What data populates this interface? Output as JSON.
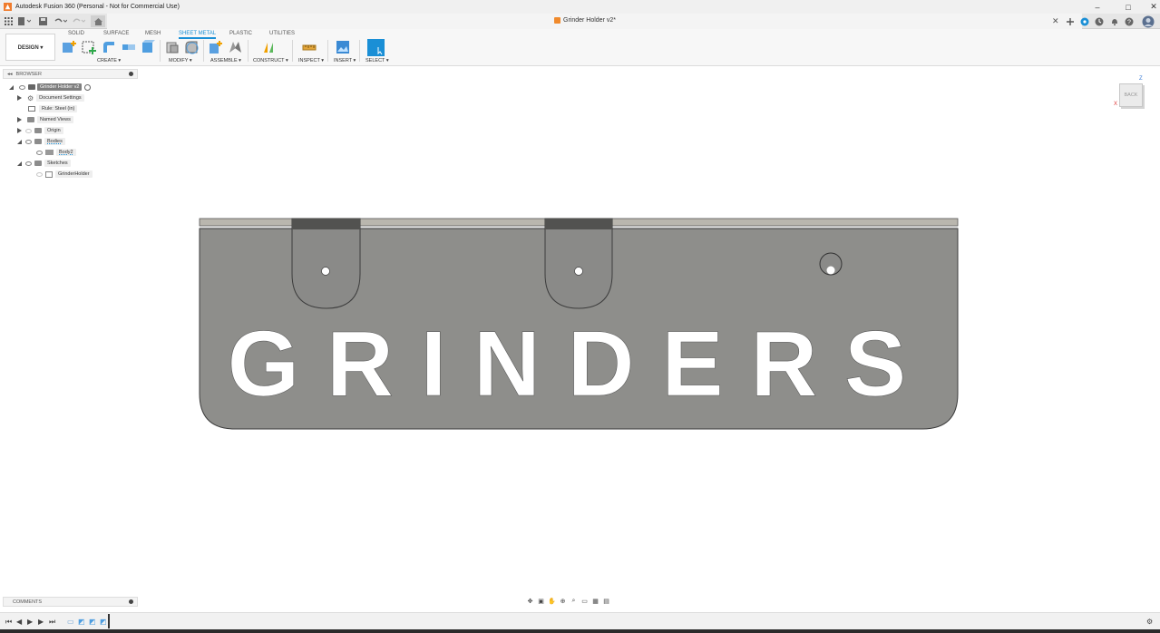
{
  "window": {
    "title": "Autodesk Fusion 360 (Personal - Not for Commercial Use)",
    "min": "–",
    "max": "□",
    "close": "✕"
  },
  "document": {
    "title": "Grinder Holder v2*",
    "close": "✕"
  },
  "workspace": {
    "label": "DESIGN ▾"
  },
  "tabs": [
    "SOLID",
    "SURFACE",
    "MESH",
    "SHEET METAL",
    "PLASTIC",
    "UTILITIES"
  ],
  "active_tab": "SHEET METAL",
  "groups": {
    "create": "CREATE ▾",
    "modify": "MODIFY ▾",
    "assemble": "ASSEMBLE ▾",
    "construct": "CONSTRUCT ▾",
    "inspect": "INSPECT ▾",
    "insert": "INSERT ▾",
    "select": "SELECT ▾"
  },
  "browser": {
    "header": "BROWSER",
    "items": [
      {
        "label": "Grinder Holder v2"
      },
      {
        "label": "Document Settings"
      },
      {
        "label": "Rule: Steel (in)"
      },
      {
        "label": "Named Views"
      },
      {
        "label": "Origin"
      },
      {
        "label": "Bodies"
      },
      {
        "label": "Body2"
      },
      {
        "label": "Sketches"
      },
      {
        "label": "GrinderHolder"
      }
    ]
  },
  "viewcube": {
    "face": "BACK",
    "axis_z": "Z",
    "axis_x": "X"
  },
  "part": {
    "text": "GRINDERS",
    "color": "#8e8e8b"
  },
  "comments": {
    "label": "COMMENTS"
  },
  "colors": {
    "accent": "#1a8fd6",
    "part_fill": "#8e8e8b",
    "part_edge": "#3c3c3c"
  }
}
